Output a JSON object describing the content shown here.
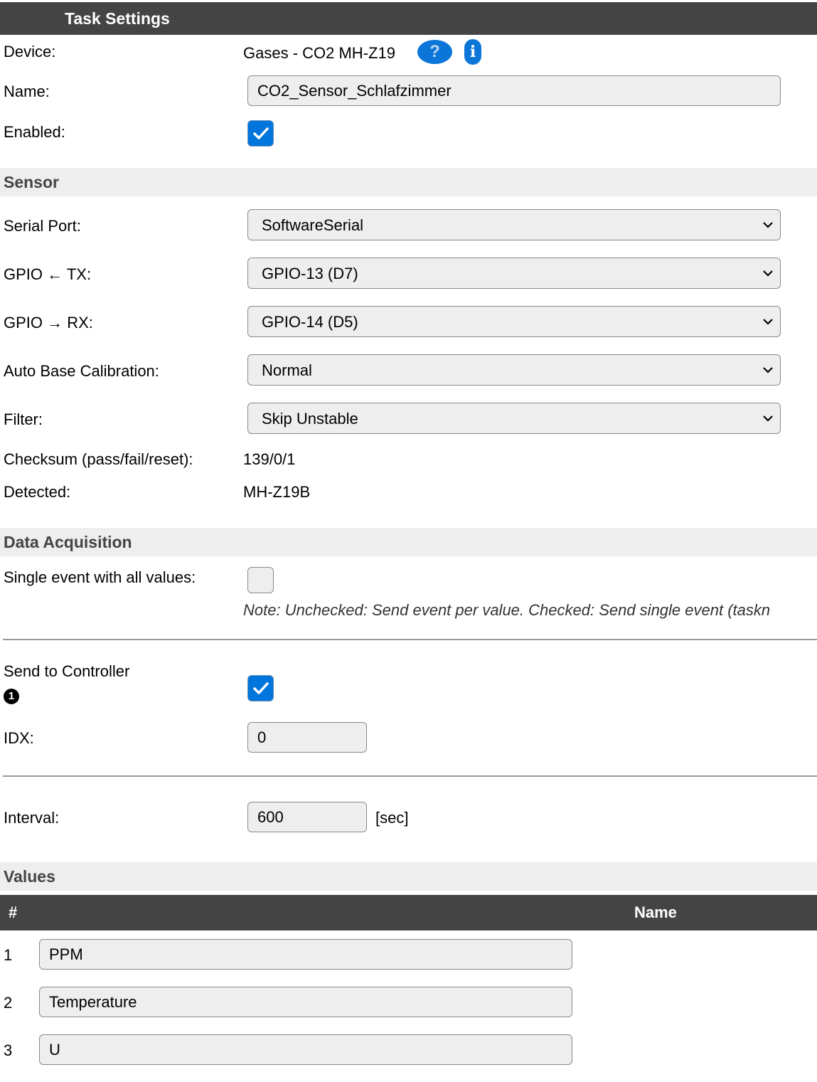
{
  "header": {
    "title": "Task Settings"
  },
  "device": {
    "label": "Device:",
    "value": "Gases - CO2 MH-Z19",
    "help_icon": "question-circle-icon",
    "help_glyph": "?",
    "info_icon": "info-icon",
    "info_glyph": "i"
  },
  "name": {
    "label": "Name:",
    "value": "CO2_Sensor_Schlafzimmer"
  },
  "enabled": {
    "label": "Enabled:",
    "checked": true
  },
  "sections": {
    "sensor": "Sensor",
    "data_acquisition": "Data Acquisition",
    "values": "Values"
  },
  "sensor": {
    "serial_port": {
      "label": "Serial Port:",
      "value": "SoftwareSerial"
    },
    "gpio_tx": {
      "label": "GPIO ← TX:",
      "value": "GPIO-13 (D7)"
    },
    "gpio_rx": {
      "label": "GPIO → RX:",
      "value": "GPIO-14 (D5)"
    },
    "abc": {
      "label": "Auto Base Calibration:",
      "value": "Normal"
    },
    "filter": {
      "label": "Filter:",
      "value": "Skip Unstable"
    },
    "checksum": {
      "label": "Checksum (pass/fail/reset):",
      "value": "139/0/1"
    },
    "detected": {
      "label": "Detected:",
      "value": "MH-Z19B"
    }
  },
  "data_acquisition": {
    "single_event": {
      "label": "Single event with all values:",
      "checked": false
    },
    "note": "Note: Unchecked: Send event per value. Checked: Send single event (taskn",
    "send_to_controller": {
      "label": "Send to Controller",
      "controller_number": "1",
      "checked": true
    },
    "idx": {
      "label": "IDX:",
      "value": "0"
    },
    "interval": {
      "label": "Interval:",
      "value": "600",
      "unit": "[sec]"
    }
  },
  "values_table": {
    "columns": [
      "#",
      "Name"
    ],
    "rows": [
      {
        "num": "1",
        "name": "PPM"
      },
      {
        "num": "2",
        "name": "Temperature"
      },
      {
        "num": "3",
        "name": "U"
      }
    ]
  },
  "colors": {
    "header_bg": "#444444",
    "section_bg": "#eeeeee",
    "accent": "#0075db",
    "input_bg": "#eeeeee"
  }
}
